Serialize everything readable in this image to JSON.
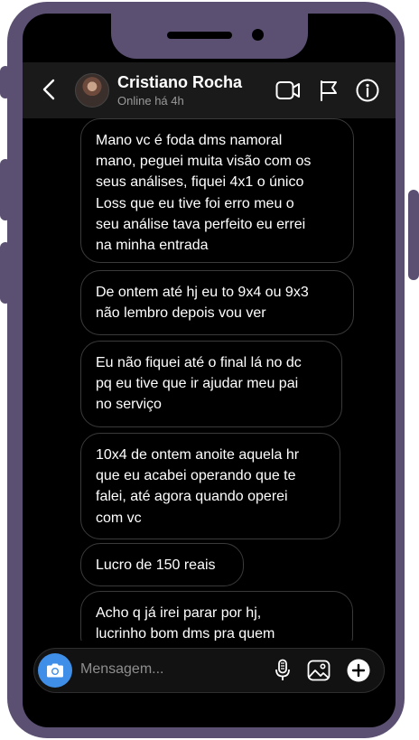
{
  "contact": {
    "name": "Cristiano Rocha",
    "status": "Online há 4h"
  },
  "messages": [
    "Mano vc é foda dms namoral\nmano, peguei muita visão com os\nseus análises, fiquei 4x1 o único\nLoss que eu tive foi erro meu o\nseu análise tava perfeito eu errei\nna minha entrada",
    "De ontem até hj eu to 9x4 ou 9x3\nnão lembro depois vou ver",
    "Eu não fiquei até o final lá no dc\npq eu tive que ir ajudar meu pai\nno serviço",
    "10x4 de ontem anoite aquela hr\nque eu acabei operando que te\nfalei, até agora quando operei\ncom vc",
    "Lucro de 150 reais",
    "Acho q já irei parar por hj,\nlucrinho bom dms pra quem"
  ],
  "composer": {
    "placeholder": "Mensagem..."
  },
  "icons": {
    "back": "chevron-left-icon",
    "video": "video-camera-icon",
    "flag": "flag-icon",
    "info": "info-icon",
    "camera": "camera-icon",
    "mic": "microphone-icon",
    "gallery": "image-icon",
    "add": "plus-circle-icon"
  },
  "colors": {
    "frame": "#5b5072",
    "screen": "#000000",
    "header": "#1a1a1a",
    "bubble_border": "#3a3a3a",
    "camera_button": "#3f8fe8"
  }
}
